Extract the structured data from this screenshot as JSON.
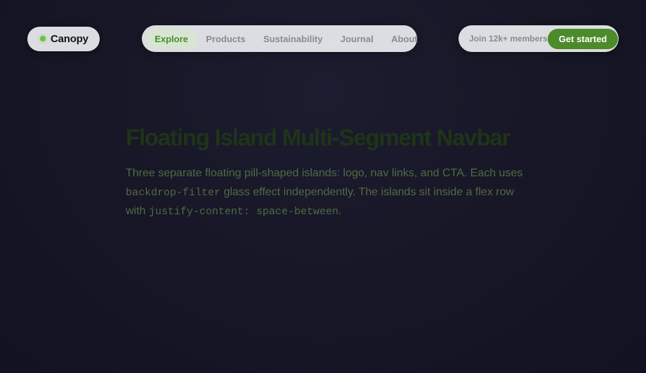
{
  "logo": {
    "name": "Canopy",
    "icon": "green-dot-icon",
    "accent": "#6cc24a"
  },
  "nav": {
    "links": [
      {
        "label": "Explore",
        "active": true
      },
      {
        "label": "Products",
        "active": false
      },
      {
        "label": "Sustainability",
        "active": false
      },
      {
        "label": "Journal",
        "active": false
      },
      {
        "label": "About",
        "active": false
      }
    ]
  },
  "cta": {
    "members_text": "Join 12k+ members",
    "button_label": "Get started",
    "button_color": "#4c8a2a"
  },
  "hero": {
    "title": "Floating Island Multi-Segment Navbar",
    "desc_1": "Three separate floating pill-shaped islands: logo, nav links, and CTA. Each uses ",
    "code_1": "backdrop-filter",
    "desc_2": " glass effect independently. The islands sit inside a flex row with ",
    "code_2": "justify-content: space-between",
    "desc_3": "."
  }
}
